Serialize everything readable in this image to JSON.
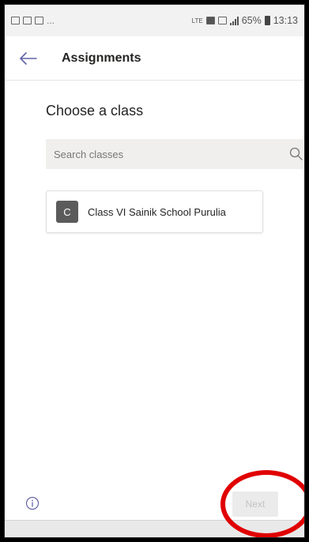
{
  "status_bar": {
    "dots": "...",
    "battery_percent": "65%",
    "time": "13:13",
    "network_small": "LTE"
  },
  "header": {
    "title": "Assignments",
    "back_icon": "arrow-left-icon"
  },
  "main": {
    "section_title": "Choose a class",
    "search": {
      "placeholder": "Search classes",
      "value": "",
      "icon": "search-icon"
    },
    "classes": [
      {
        "avatar_letter": "C",
        "name": "Class VI Sainik School Purulia"
      }
    ]
  },
  "footer": {
    "info_icon": "info-icon",
    "next_label": "Next",
    "next_enabled": false
  },
  "colors": {
    "accent": "#6264a7",
    "avatar_bg": "#5b5b5b",
    "highlight": "#e00000",
    "search_bg": "#f0efee"
  }
}
